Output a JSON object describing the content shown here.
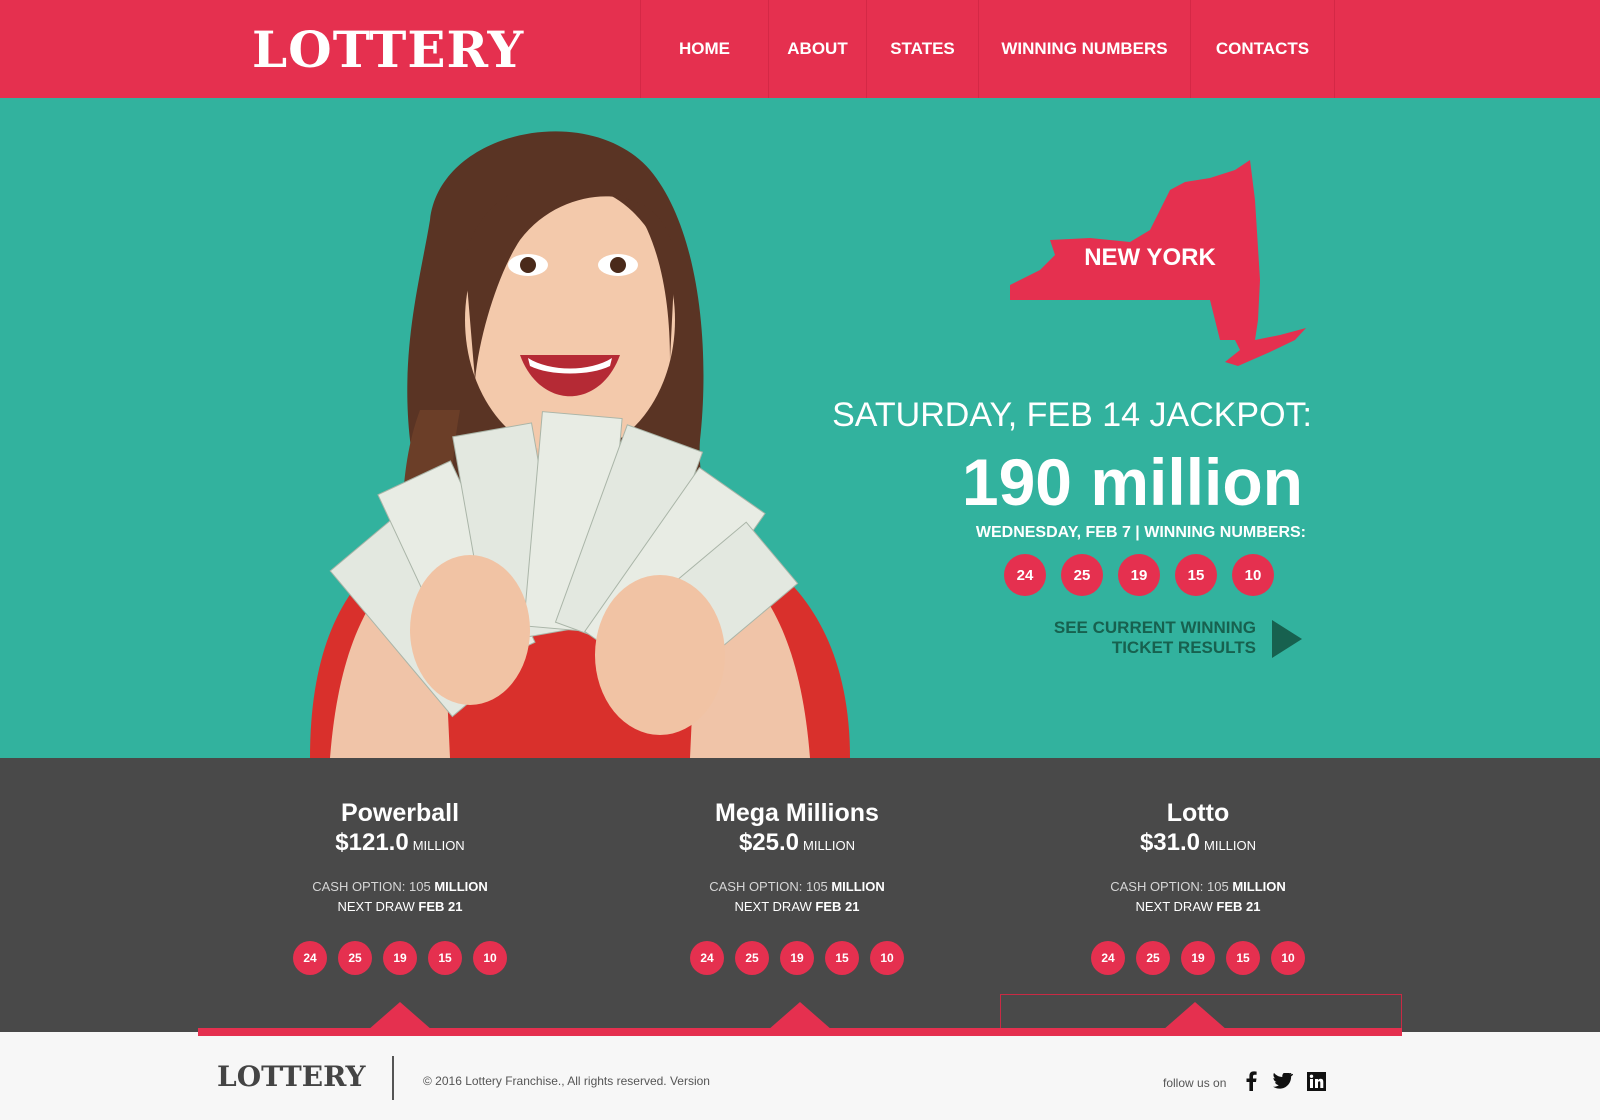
{
  "header": {
    "logo": "LOTTERY",
    "nav": [
      "HOME",
      "ABOUT",
      "STATES",
      "WINNING NUMBERS",
      "CONTACTS"
    ]
  },
  "hero": {
    "state": "NEW YORK",
    "jackpot_label": "SATURDAY, FEB 14 JACKPOT:",
    "jackpot_amount": "190 million",
    "winning_label": "WEDNESDAY, FEB 7 | WINNING NUMBERS:",
    "numbers": [
      "24",
      "25",
      "19",
      "15",
      "10"
    ],
    "cta_line1": "SEE CURRENT WINNING",
    "cta_line2": "TICKET RESULTS"
  },
  "games": [
    {
      "name": "Powerball",
      "prize": "$121.0",
      "unit": "MILLION",
      "cash_label": "CASH OPTION: 105",
      "cash_unit": "MILLION",
      "next_label": "NEXT DRAW",
      "next_date": "FEB 21",
      "numbers": [
        "24",
        "25",
        "19",
        "15",
        "10"
      ]
    },
    {
      "name": "Mega Millions",
      "prize": "$25.0",
      "unit": "MILLION",
      "cash_label": "CASH OPTION: 105",
      "cash_unit": "MILLION",
      "next_label": "NEXT DRAW",
      "next_date": "FEB 21",
      "numbers": [
        "24",
        "25",
        "19",
        "15",
        "10"
      ]
    },
    {
      "name": "Lotto",
      "prize": "$31.0",
      "unit": "MILLION",
      "cash_label": "CASH OPTION: 105",
      "cash_unit": "MILLION",
      "next_label": "NEXT DRAW",
      "next_date": "FEB 21",
      "numbers": [
        "24",
        "25",
        "19",
        "15",
        "10"
      ]
    }
  ],
  "footer": {
    "logo": "LOTTERY",
    "copyright": "© 2016 Lottery Franchise., All rights reserved. Version",
    "follow": "follow us on",
    "social": [
      "facebook-icon",
      "twitter-icon",
      "linkedin-icon"
    ]
  },
  "colors": {
    "brand": "#e5304f",
    "hero_bg": "#32b29e",
    "band_bg": "#494949",
    "cta": "#17614f"
  }
}
